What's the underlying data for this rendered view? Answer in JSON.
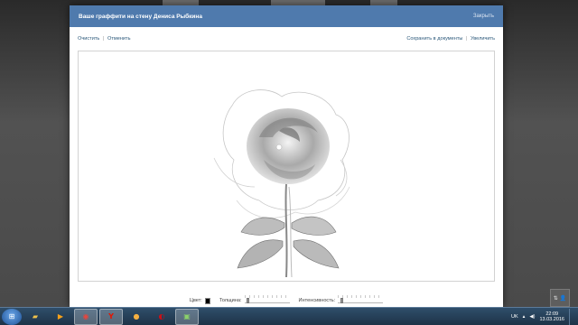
{
  "modal": {
    "title": "Ваше граффити на стену Дениса Рыбкина",
    "close_label": "Закрыть"
  },
  "toolbar": {
    "clear_label": "Очистить",
    "undo_label": "Отменить",
    "separator": "|",
    "save_label": "Сохранить в документы",
    "enlarge_label": "Увеличить"
  },
  "controls": {
    "color_label": "Цвет:",
    "thickness_label": "Толщина:",
    "intensity_label": "Интенсивность:",
    "thickness_value": 0.05,
    "intensity_value": 0.05,
    "color": "#000000"
  },
  "taskbar": {
    "apps": [
      "windows-explorer",
      "media-player",
      "chrome",
      "yandex-browser",
      "pidgin",
      "opera",
      "graffiti-app"
    ],
    "tray_lang": "UK",
    "time": "22:09",
    "date": "13.03.2016"
  },
  "colors": {
    "header": "#4f7aad",
    "link": "#2b587a",
    "taskbar": "#1e3348"
  }
}
